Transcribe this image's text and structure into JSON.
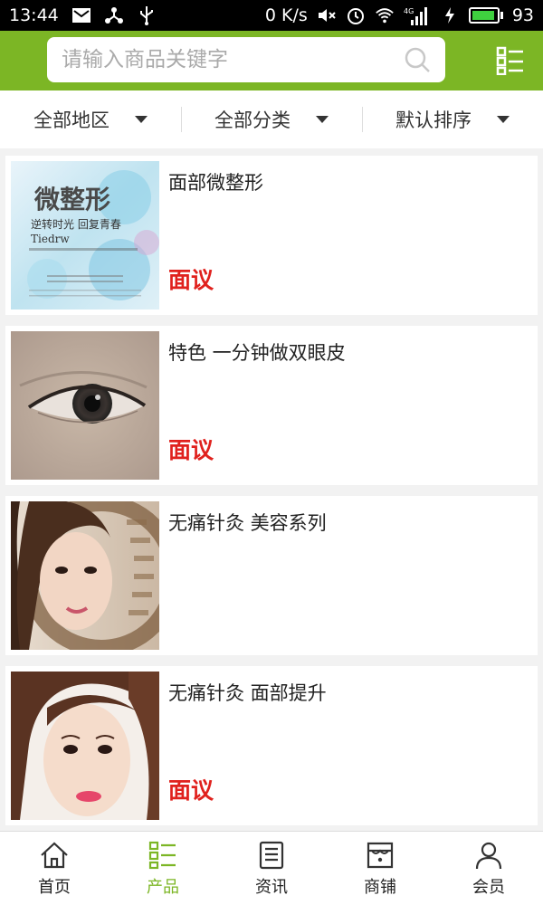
{
  "status_bar": {
    "time": "13:44",
    "network_speed": "0 K/s",
    "signal_type": "4G",
    "battery": "93",
    "battery_level": 0.93
  },
  "search": {
    "placeholder": "请输入商品关键字"
  },
  "filters": [
    {
      "label": "全部地区"
    },
    {
      "label": "全部分类"
    },
    {
      "label": "默认排序"
    }
  ],
  "products": [
    {
      "title": "面部微整形",
      "price": "面议",
      "thumb_text": {
        "big": "微整形",
        "line2": "逆转时光 回复青春",
        "line3": "Tiedrw"
      }
    },
    {
      "title": "特色 一分钟做双眼皮",
      "price": "面议"
    },
    {
      "title": "无痛针灸 美容系列",
      "price": ""
    },
    {
      "title": "无痛针灸 面部提升",
      "price": "面议"
    }
  ],
  "bottom_nav": [
    {
      "label": "首页",
      "icon": "home-icon"
    },
    {
      "label": "产品",
      "icon": "product-list-icon",
      "active": true
    },
    {
      "label": "资讯",
      "icon": "news-icon"
    },
    {
      "label": "商铺",
      "icon": "store-icon"
    },
    {
      "label": "会员",
      "icon": "member-icon"
    }
  ],
  "colors": {
    "brand_green": "#7cb625",
    "price_red": "#e0221e"
  }
}
